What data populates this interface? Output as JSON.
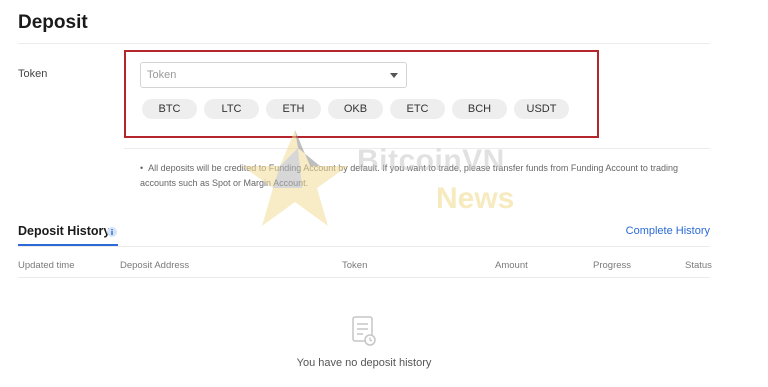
{
  "page": {
    "title": "Deposit"
  },
  "token": {
    "label": "Token",
    "select_placeholder": "Token",
    "chips": [
      "BTC",
      "LTC",
      "ETH",
      "OKB",
      "ETC",
      "BCH",
      "USDT"
    ]
  },
  "note": {
    "text": "All deposits will be credited to Funding Account by default. If you want to trade, please transfer funds from Funding Account to trading accounts such as Spot or Margin Account."
  },
  "watermark": {
    "brand": "BitcoinVN",
    "sub": "News"
  },
  "history": {
    "title": "Deposit History",
    "complete_link": "Complete History",
    "columns": [
      "Updated time",
      "Deposit Address",
      "Token",
      "Amount",
      "Progress",
      "Status"
    ],
    "empty_text": "You have no deposit history"
  },
  "colors": {
    "accent": "#2b6ad8",
    "highlight_border": "#b4262c",
    "chip_bg": "#eeeeee"
  },
  "icons": {
    "select_arrow": "chevron-down-icon",
    "info": "info-icon",
    "empty": "document-icon"
  }
}
